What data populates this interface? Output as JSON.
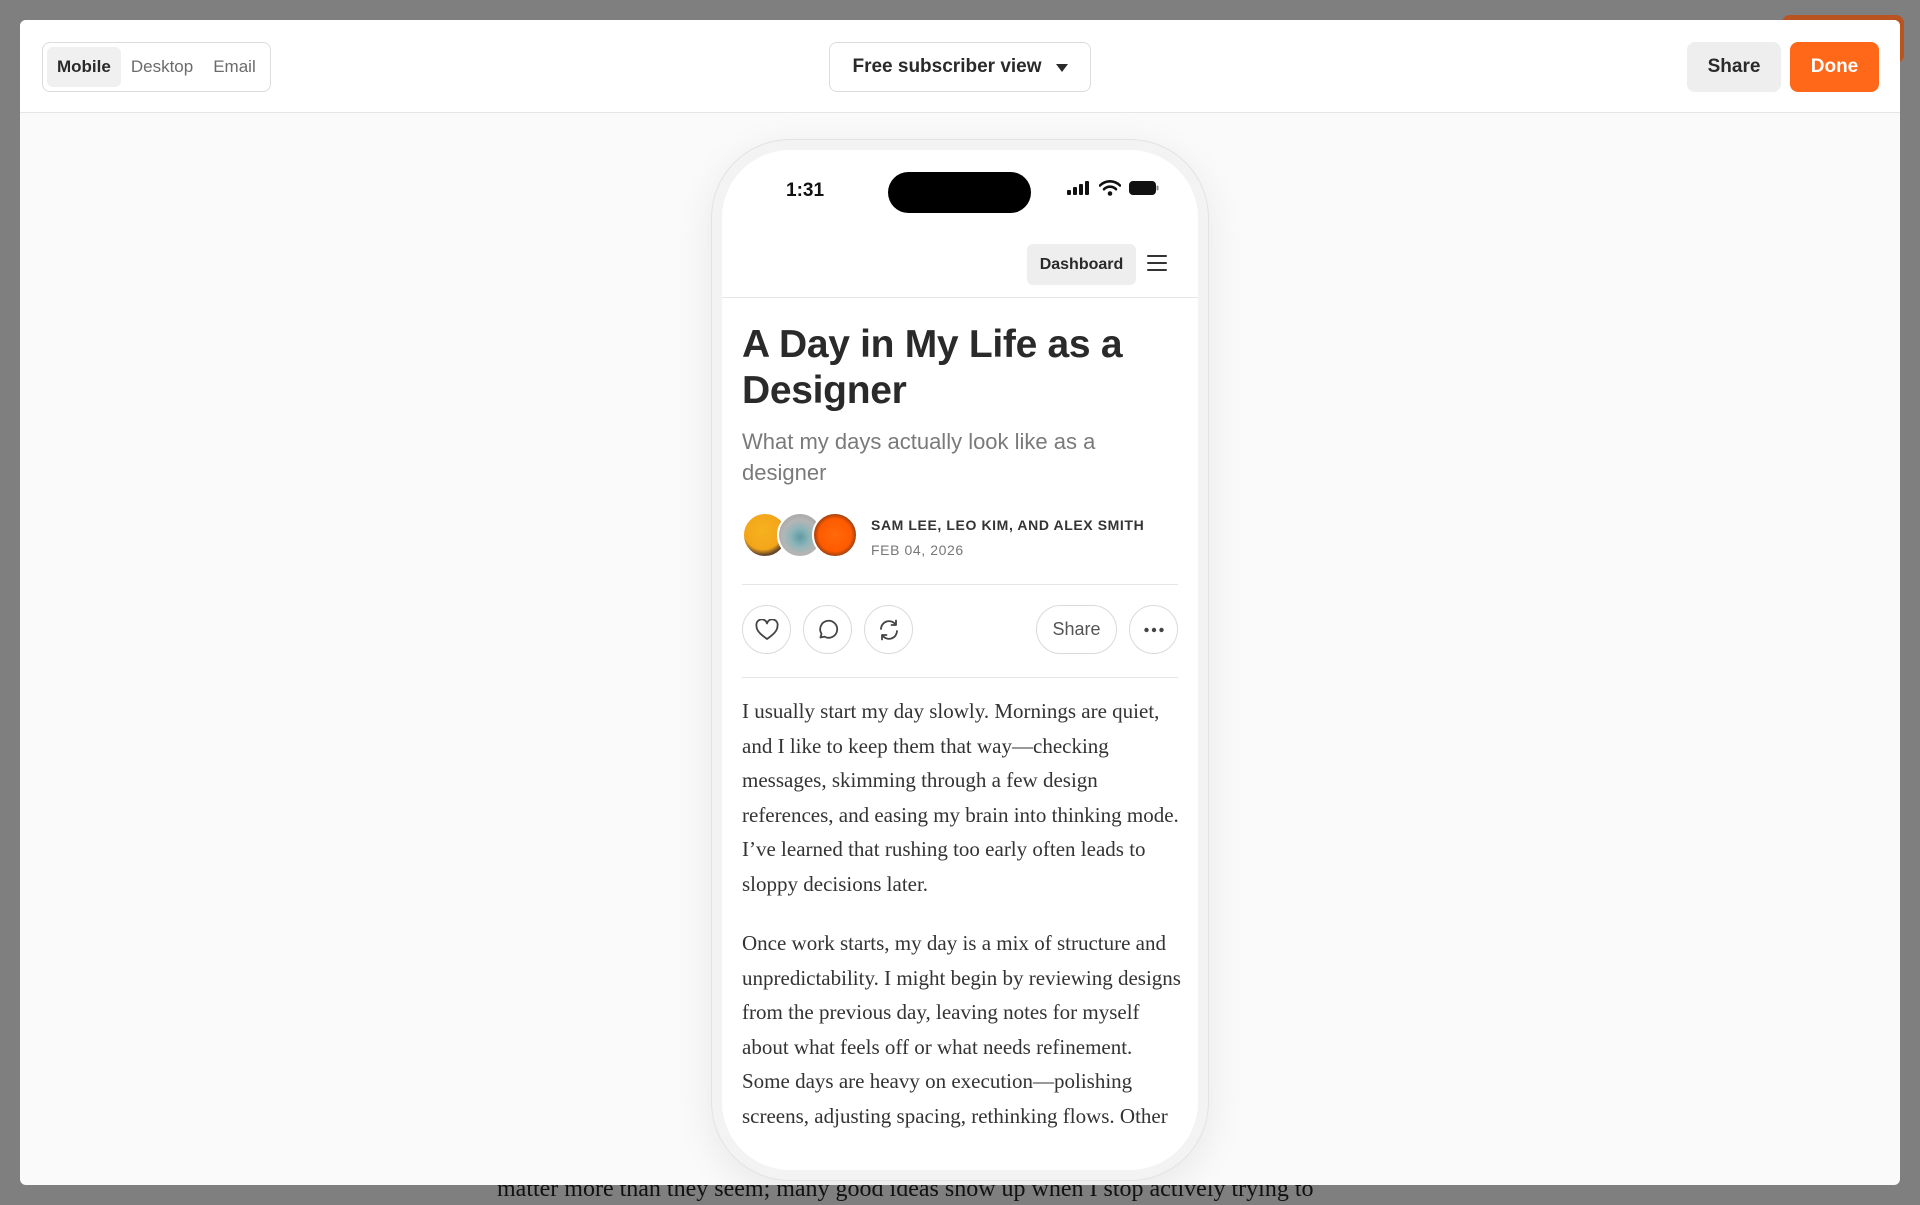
{
  "background": {
    "text": "matter more than they seem; many good ideas show up when I stop actively trying to"
  },
  "header": {
    "view_modes": [
      "Mobile",
      "Desktop",
      "Email"
    ],
    "active_view_mode": "Mobile",
    "audience_select": "Free subscriber view",
    "share_label": "Share",
    "done_label": "Done"
  },
  "colors": {
    "accent": "#ff6719"
  },
  "phone": {
    "status_time": "1:31",
    "dashboard_label": "Dashboard",
    "post": {
      "title": "A Day in My Life as a Designer",
      "subtitle": "What my days actually look like as a designer",
      "authors": "SAM LEE, LEO KIM, AND ALEX SMITH",
      "date": "FEB 04, 2026",
      "share_label": "Share",
      "paragraphs": [
        "I usually start my day slowly. Mornings are quiet, and I like to keep them that way—checking messages, skimming through a few design references, and easing my brain into thinking mode. I’ve learned that rushing too early often leads to sloppy decisions later.",
        "Once work starts, my day is a mix of structure and unpredictability. I might begin by reviewing designs from the previous day, leaving notes for myself about what feels off or what needs refinement. Some days are heavy on execution—polishing screens, adjusting spacing, rethinking flows. Other"
      ]
    }
  }
}
